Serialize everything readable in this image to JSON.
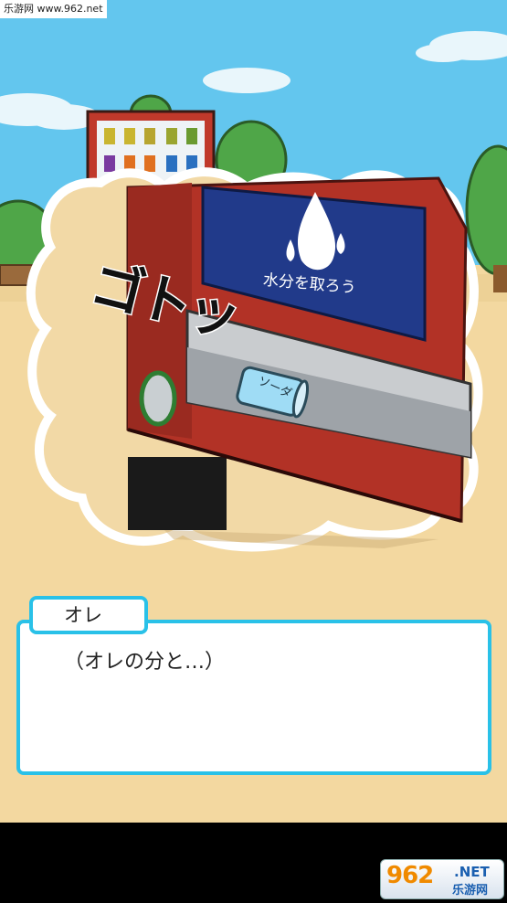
{
  "watermark": {
    "site": "乐游网 www.962.net"
  },
  "scene": {
    "sign_text": "水分を取ろう",
    "sound_effect": "ゴトッ",
    "can_label": "ソーダ"
  },
  "dialog": {
    "speaker": "オレ",
    "text": "（オレの分と…）"
  },
  "logo": {
    "number": "962",
    "net": ".NET",
    "cn": "乐游网"
  },
  "colors": {
    "sky": "#63c6ee",
    "ground": "#f3d8a0",
    "machine_red": "#b23226",
    "sign_blue": "#213a8a",
    "dialog_border": "#29c1e8"
  }
}
